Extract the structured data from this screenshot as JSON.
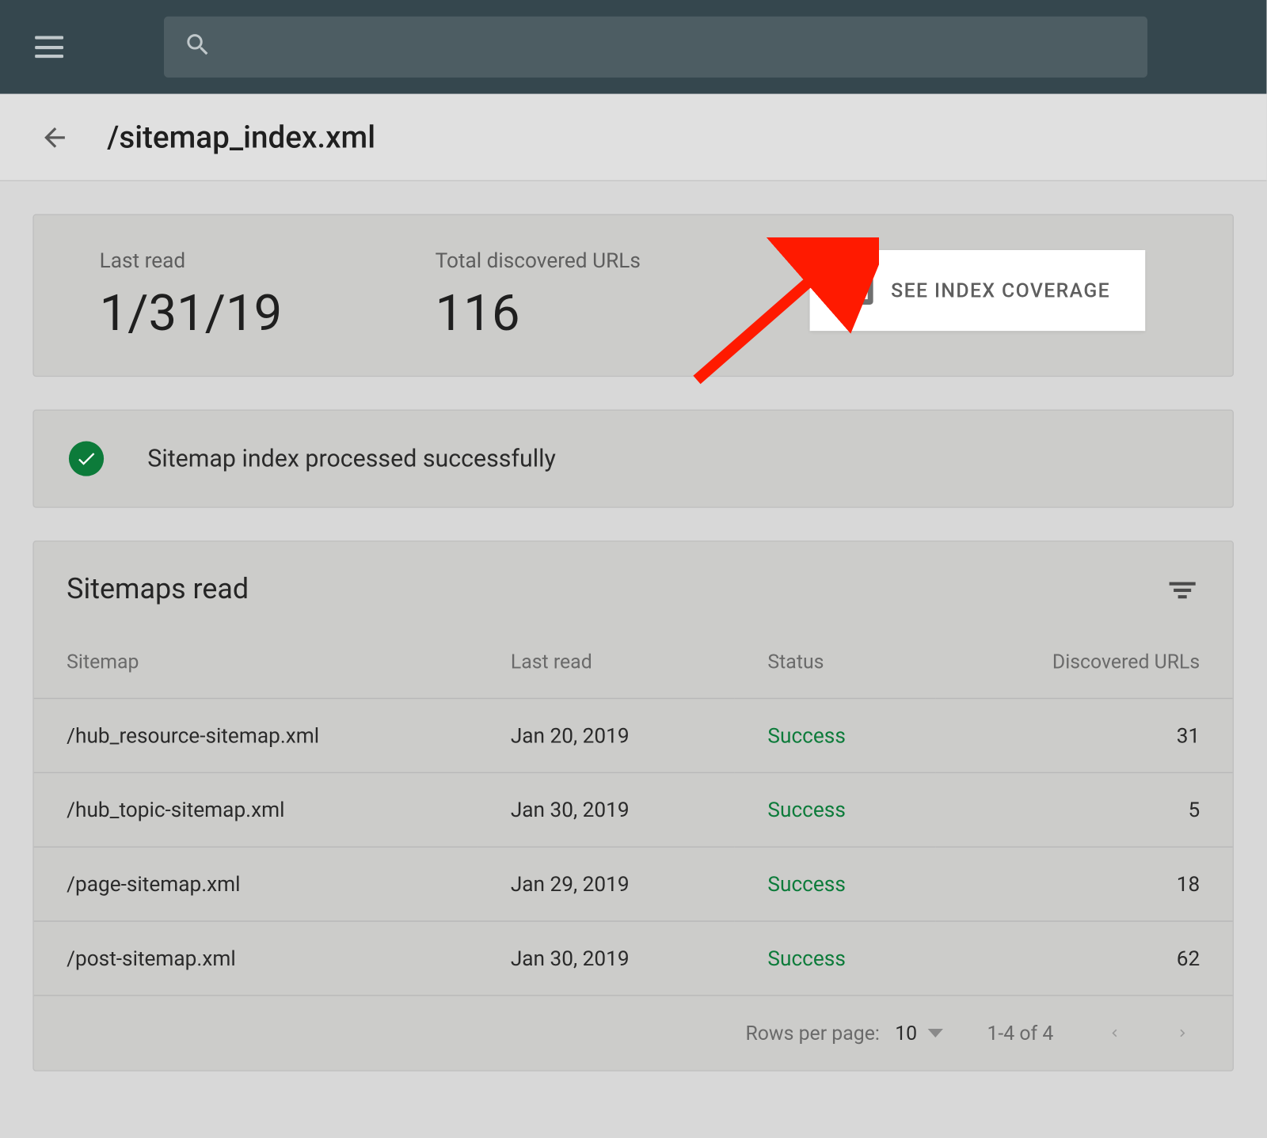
{
  "header": {
    "page_title": "/sitemap_index.xml"
  },
  "stats": {
    "last_read_label": "Last read",
    "last_read_value": "1/31/19",
    "total_urls_label": "Total discovered URLs",
    "total_urls_value": "116",
    "coverage_button": "SEE INDEX COVERAGE"
  },
  "status": {
    "message": "Sitemap index processed successfully"
  },
  "table": {
    "title": "Sitemaps read",
    "columns": {
      "sitemap": "Sitemap",
      "last_read": "Last read",
      "status": "Status",
      "discovered": "Discovered URLs"
    },
    "rows": [
      {
        "sitemap": "/hub_resource-sitemap.xml",
        "last_read": "Jan 20, 2019",
        "status": "Success",
        "discovered": "31"
      },
      {
        "sitemap": "/hub_topic-sitemap.xml",
        "last_read": "Jan 30, 2019",
        "status": "Success",
        "discovered": "5"
      },
      {
        "sitemap": "/page-sitemap.xml",
        "last_read": "Jan 29, 2019",
        "status": "Success",
        "discovered": "18"
      },
      {
        "sitemap": "/post-sitemap.xml",
        "last_read": "Jan 30, 2019",
        "status": "Success",
        "discovered": "62"
      }
    ],
    "footer": {
      "rows_per_page_label": "Rows per page:",
      "rows_per_page_value": "10",
      "range": "1-4 of 4"
    }
  }
}
